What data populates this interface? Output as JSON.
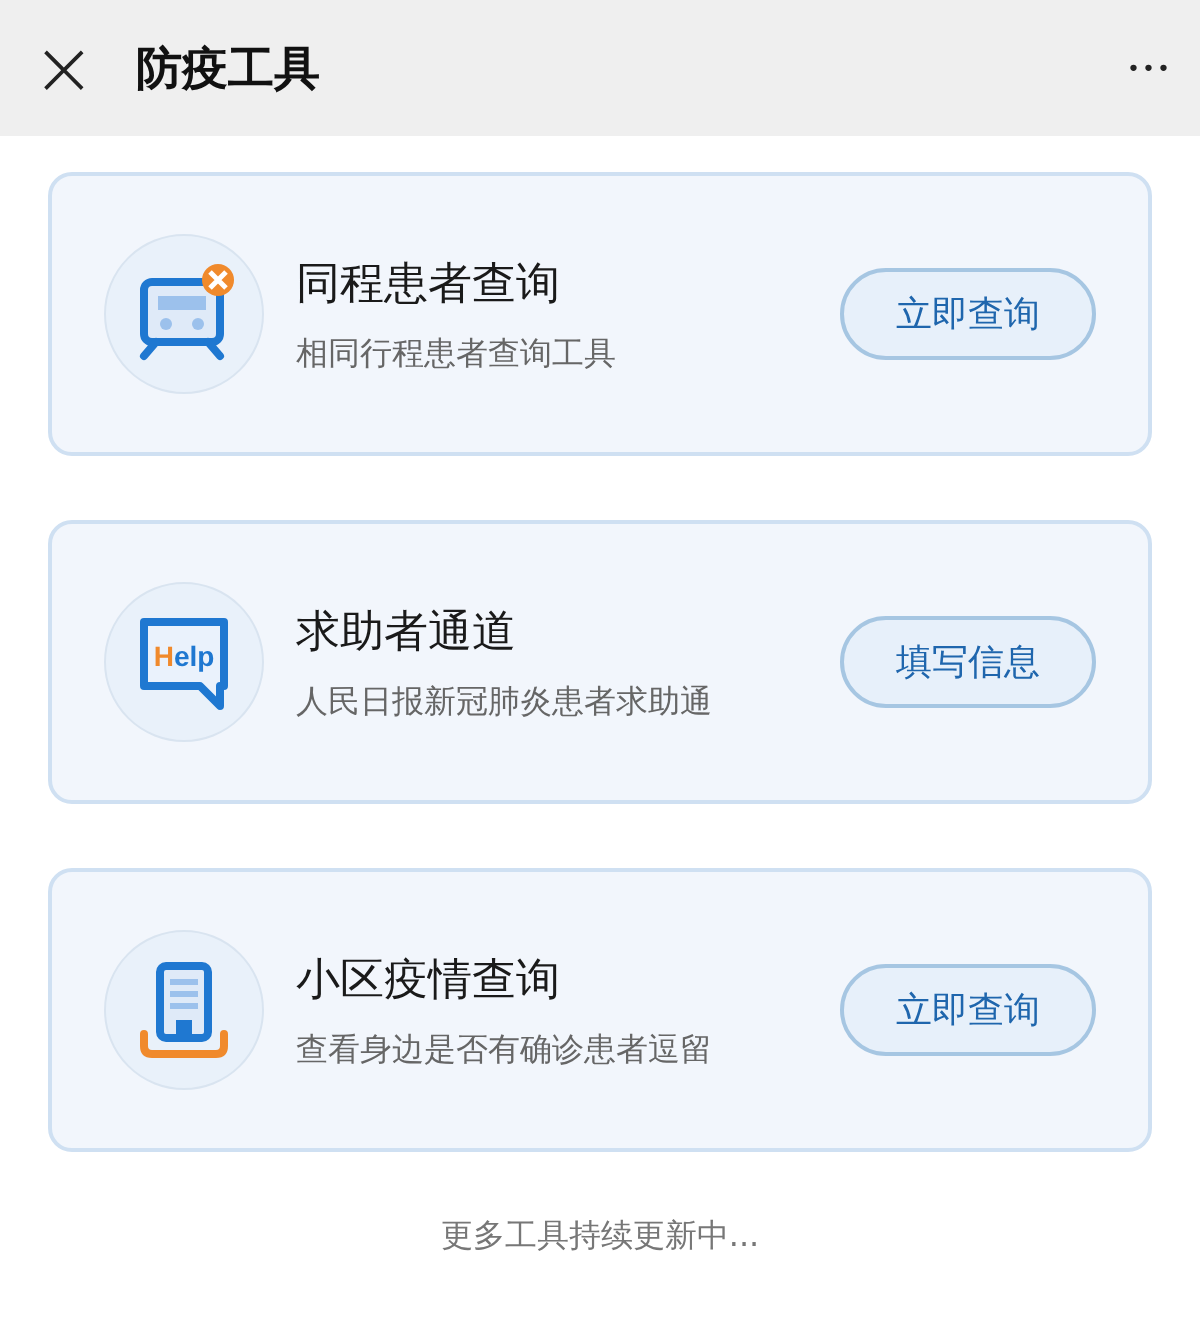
{
  "window": {
    "title": "防疫工具",
    "close_glyph": "×",
    "more_glyph": "•••"
  },
  "tools": [
    {
      "kind": "train",
      "title": "同程患者查询",
      "subtitle": "相同行程患者查询工具",
      "button": "立即查询"
    },
    {
      "kind": "help",
      "icon_text": "Help",
      "title": "求助者通道",
      "subtitle": "人民日报新冠肺炎患者求助通",
      "button": "填写信息"
    },
    {
      "kind": "building",
      "title": "小区疫情查询",
      "subtitle": "查看身边是否有确诊患者逗留",
      "button": "立即查询"
    }
  ],
  "footer": "更多工具持续更新中..."
}
